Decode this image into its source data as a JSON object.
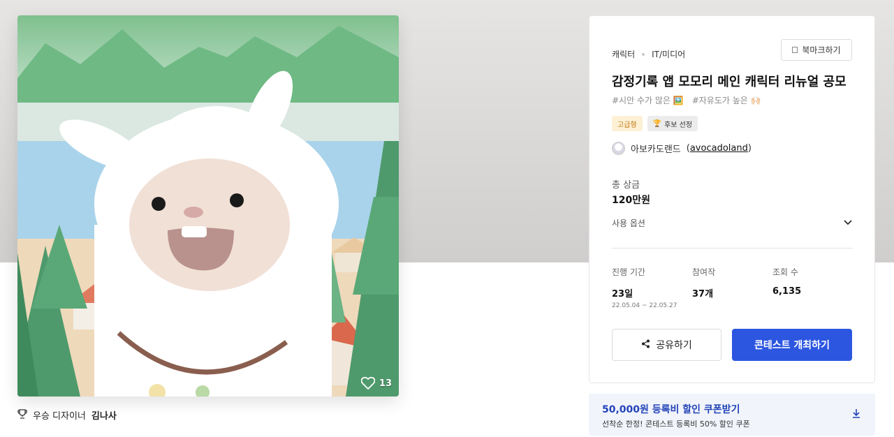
{
  "artwork": {
    "like_count": "13"
  },
  "award": {
    "label": "우승 디자이너",
    "designer": "김나사"
  },
  "contest": {
    "categories": [
      "캐릭터",
      "IT/미디어"
    ],
    "bookmark_label": "북마크하기",
    "title": "감정기록 앱 모모리 메인 캐릭터 리뉴얼 공모",
    "tags": [
      "#시안 수가 많은 🖼️",
      "#자유도가 높은 🙌🏻"
    ],
    "badges": {
      "premium": "고급형",
      "candidate": "후보 선정"
    },
    "host_name": "아보카도랜드",
    "host_handle": "avocadoland",
    "prize_label": "총 상금",
    "prize_value": "120만원",
    "options_label": "사용 옵션",
    "stats": {
      "period_label": "진행 기간",
      "period_value": "23일",
      "period_dates": "22.05.04 ~ 22.05.27",
      "entries_label": "참여작",
      "entries_value": "37개",
      "views_label": "조회 수",
      "views_value": "6,135"
    },
    "share_label": "공유하기",
    "open_contest_label": "콘테스트 개최하기"
  },
  "coupon": {
    "title": "50,000원 등록비 할인 쿠폰받기",
    "subtitle": "선착순 한정! 콘테스트 등록비 50% 할인 쿠폰"
  },
  "colors": {
    "primary": "#2c56e0",
    "coupon_text": "#2344b8",
    "premium_badge_bg": "#fdf0d5",
    "premium_badge_text": "#c07a12"
  },
  "icons": [
    "heart-icon",
    "trophy-icon",
    "bookmark-icon",
    "chevron-down-icon",
    "share-icon",
    "download-icon"
  ]
}
